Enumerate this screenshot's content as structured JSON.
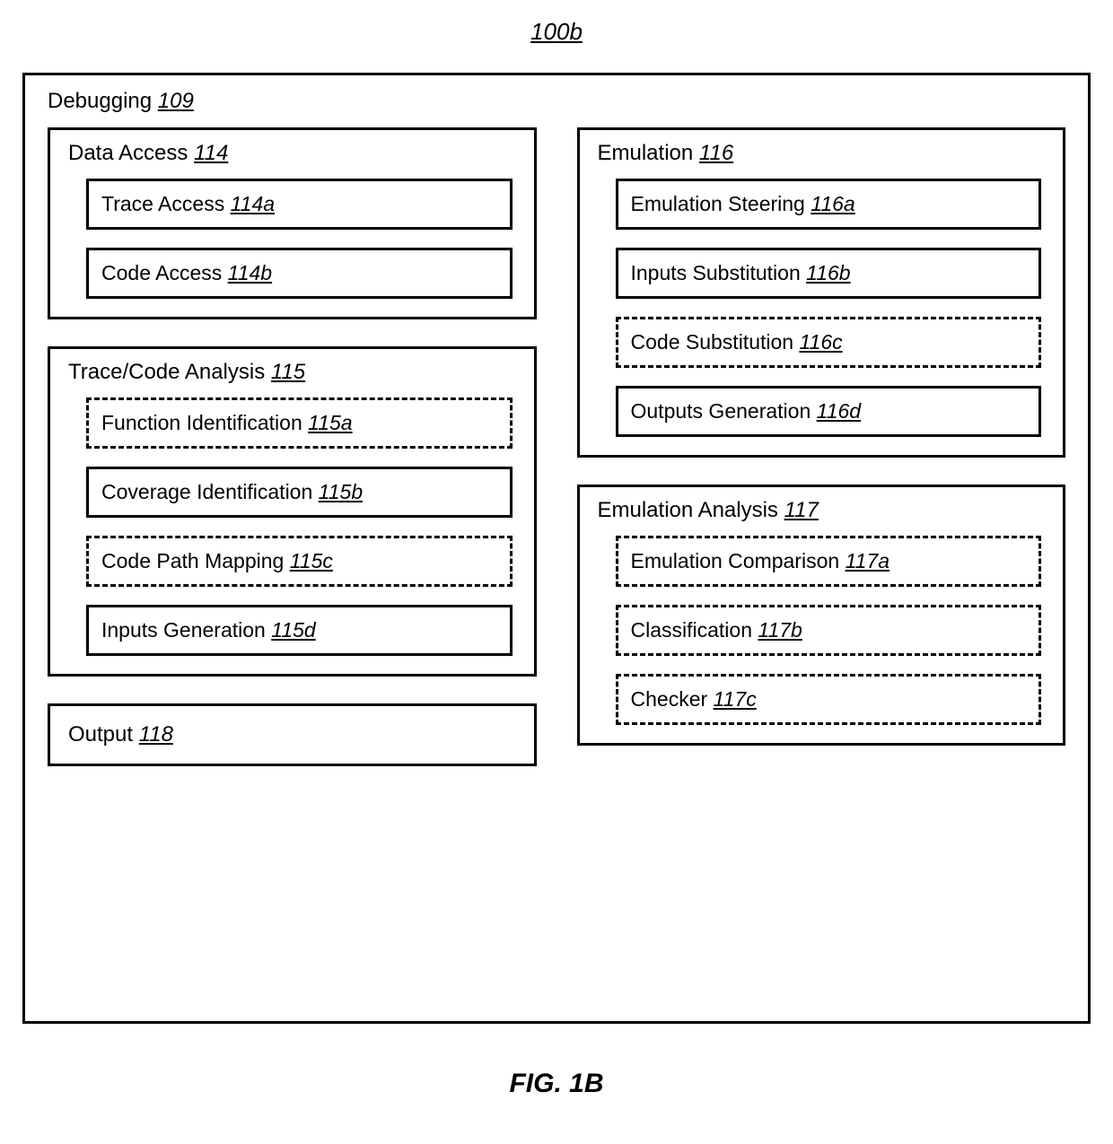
{
  "figure_id": "100b",
  "outer": {
    "label": "Debugging",
    "ref": "109"
  },
  "data_access": {
    "label": "Data Access",
    "ref": "114",
    "items": [
      {
        "label": "Trace Access",
        "ref": "114a",
        "dashed": false
      },
      {
        "label": "Code Access",
        "ref": "114b",
        "dashed": false
      }
    ]
  },
  "trace_code_analysis": {
    "label": "Trace/Code Analysis",
    "ref": "115",
    "items": [
      {
        "label": "Function Identification",
        "ref": "115a",
        "dashed": true
      },
      {
        "label": "Coverage Identification",
        "ref": "115b",
        "dashed": false
      },
      {
        "label": "Code Path Mapping",
        "ref": "115c",
        "dashed": true
      },
      {
        "label": "Inputs Generation",
        "ref": "115d",
        "dashed": false
      }
    ]
  },
  "output": {
    "label": "Output",
    "ref": "118"
  },
  "emulation": {
    "label": "Emulation",
    "ref": "116",
    "items": [
      {
        "label": "Emulation Steering",
        "ref": "116a",
        "dashed": false
      },
      {
        "label": "Inputs Substitution",
        "ref": "116b",
        "dashed": false
      },
      {
        "label": "Code Substitution",
        "ref": "116c",
        "dashed": true
      },
      {
        "label": "Outputs Generation",
        "ref": "116d",
        "dashed": false
      }
    ]
  },
  "emulation_analysis": {
    "label": "Emulation Analysis",
    "ref": "117",
    "items": [
      {
        "label": "Emulation Comparison",
        "ref": "117a",
        "dashed": true
      },
      {
        "label": "Classification",
        "ref": "117b",
        "dashed": true
      },
      {
        "label": "Checker",
        "ref": "117c",
        "dashed": true
      }
    ]
  },
  "caption": "FIG. 1B"
}
